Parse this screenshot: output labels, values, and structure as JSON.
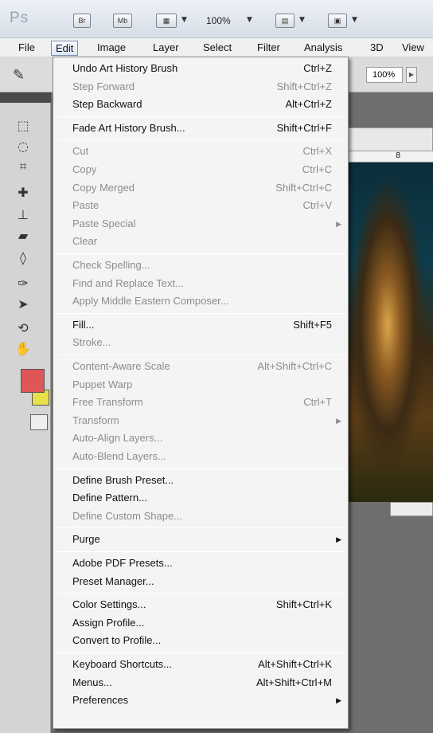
{
  "appbar": {
    "logo": "Ps",
    "bridge_label": "Br",
    "minibridge_label": "Mb",
    "zoom": "100%"
  },
  "menubar": [
    "File",
    "Edit",
    "Image",
    "Layer",
    "Select",
    "Filter",
    "Analysis",
    "3D",
    "View"
  ],
  "options": {
    "opacity_value": "100%"
  },
  "ruler": {
    "label": "8"
  },
  "menu": {
    "items": [
      {
        "label": "Undo Art History Brush",
        "shortcut": "Ctrl+Z",
        "enabled": true
      },
      {
        "label": "Step Forward",
        "shortcut": "Shift+Ctrl+Z",
        "enabled": false
      },
      {
        "label": "Step Backward",
        "shortcut": "Alt+Ctrl+Z",
        "enabled": true
      },
      {
        "label": "Fade Art History Brush...",
        "shortcut": "Shift+Ctrl+F",
        "enabled": true
      },
      {
        "label": "Cut",
        "shortcut": "Ctrl+X",
        "enabled": false
      },
      {
        "label": "Copy",
        "shortcut": "Ctrl+C",
        "enabled": false
      },
      {
        "label": "Copy Merged",
        "shortcut": "Shift+Ctrl+C",
        "enabled": false
      },
      {
        "label": "Paste",
        "shortcut": "Ctrl+V",
        "enabled": false
      },
      {
        "label": "Paste Special",
        "shortcut": "",
        "enabled": false,
        "submenu": true
      },
      {
        "label": "Clear",
        "shortcut": "",
        "enabled": false
      },
      {
        "label": "Check Spelling...",
        "shortcut": "",
        "enabled": false
      },
      {
        "label": "Find and Replace Text...",
        "shortcut": "",
        "enabled": false
      },
      {
        "label": "Apply Middle Eastern Composer...",
        "shortcut": "",
        "enabled": false
      },
      {
        "label": "Fill...",
        "shortcut": "Shift+F5",
        "enabled": true
      },
      {
        "label": "Stroke...",
        "shortcut": "",
        "enabled": false
      },
      {
        "label": "Content-Aware Scale",
        "shortcut": "Alt+Shift+Ctrl+C",
        "enabled": false
      },
      {
        "label": "Puppet Warp",
        "shortcut": "",
        "enabled": false
      },
      {
        "label": "Free Transform",
        "shortcut": "Ctrl+T",
        "enabled": false
      },
      {
        "label": "Transform",
        "shortcut": "",
        "enabled": false,
        "submenu": true
      },
      {
        "label": "Auto-Align Layers...",
        "shortcut": "",
        "enabled": false
      },
      {
        "label": "Auto-Blend Layers...",
        "shortcut": "",
        "enabled": false
      },
      {
        "label": "Define Brush Preset...",
        "shortcut": "",
        "enabled": true
      },
      {
        "label": "Define Pattern...",
        "shortcut": "",
        "enabled": true
      },
      {
        "label": "Define Custom Shape...",
        "shortcut": "",
        "enabled": false
      },
      {
        "label": "Purge",
        "shortcut": "",
        "enabled": true,
        "submenu": true
      },
      {
        "label": "Adobe PDF Presets...",
        "shortcut": "",
        "enabled": true
      },
      {
        "label": "Preset Manager...",
        "shortcut": "",
        "enabled": true
      },
      {
        "label": "Color Settings...",
        "shortcut": "Shift+Ctrl+K",
        "enabled": true
      },
      {
        "label": "Assign Profile...",
        "shortcut": "",
        "enabled": true
      },
      {
        "label": "Convert to Profile...",
        "shortcut": "",
        "enabled": true
      },
      {
        "label": "Keyboard Shortcuts...",
        "shortcut": "Alt+Shift+Ctrl+K",
        "enabled": true
      },
      {
        "label": "Menus...",
        "shortcut": "Alt+Shift+Ctrl+M",
        "enabled": true
      },
      {
        "label": "Preferences",
        "shortcut": "",
        "enabled": true,
        "submenu": true
      }
    ]
  },
  "colors": {
    "foreground": "#e05555",
    "background": "#e8e04a"
  }
}
